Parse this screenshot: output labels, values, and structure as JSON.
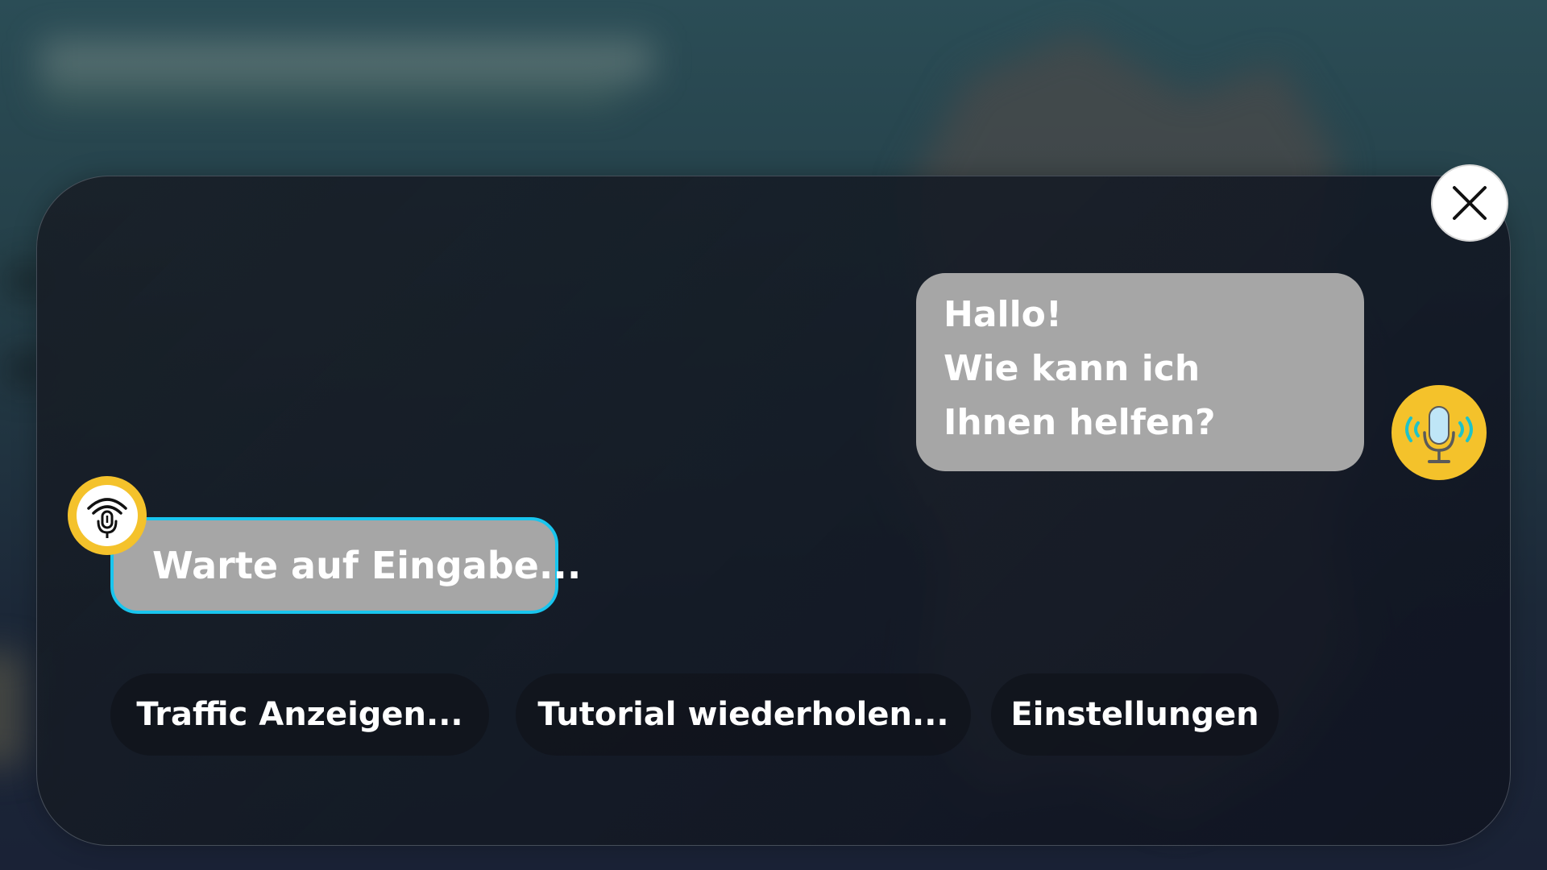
{
  "assistant": {
    "greeting_lines": [
      "Hallo!",
      "Wie kann ich",
      "Ihnen helfen?"
    ],
    "avatar_icon": "microphone-sound-icon"
  },
  "user": {
    "status_text": "Warte auf Eingabe...",
    "avatar_icon": "microphone-listening-icon"
  },
  "actions": {
    "traffic_label": "Traffic Anzeigen...",
    "tutorial_label": "Tutorial wiederholen...",
    "settings_label": "Einstellungen"
  },
  "close": {
    "icon": "close-icon"
  },
  "colors": {
    "avatar_yellow": "#f4c22b",
    "bubble_gray": "#a6a6a6",
    "active_border_cyan": "#19c5ee",
    "mic_light_blue": "#bfe6f7",
    "sound_wave_teal": "#1fc3c8"
  }
}
